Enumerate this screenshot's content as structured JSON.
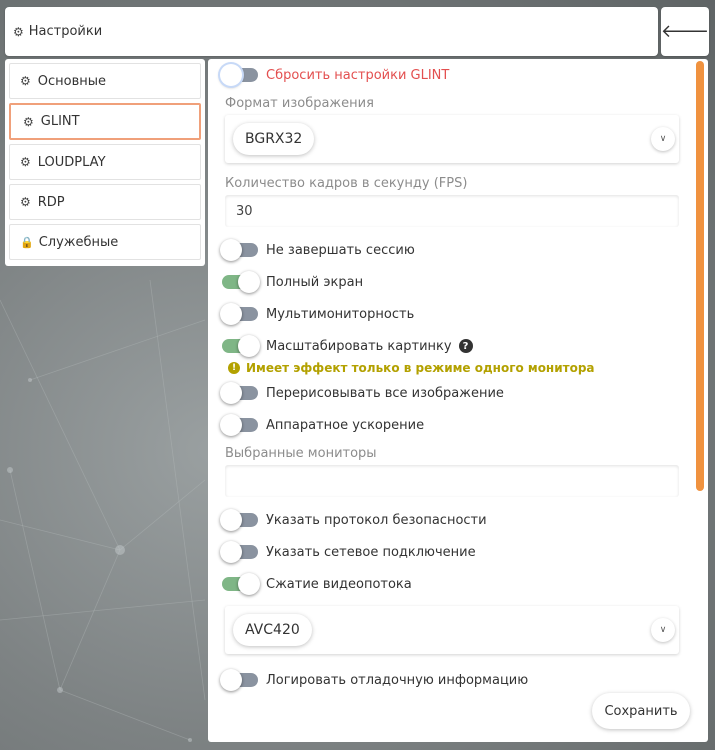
{
  "header": {
    "title": "Настройки",
    "back_icon": "arrow-left-icon"
  },
  "sidebar": {
    "items": [
      {
        "label": "Основные",
        "icon": "gear-icon",
        "active": false
      },
      {
        "label": "GLINT",
        "icon": "gear-icon",
        "active": true
      },
      {
        "label": "LOUDPLAY",
        "icon": "gear-icon",
        "active": false
      },
      {
        "label": "RDP",
        "icon": "gear-icon",
        "active": false
      },
      {
        "label": "Служебные",
        "icon": "lock-icon",
        "active": false
      }
    ]
  },
  "content": {
    "reset_glint": {
      "label": "Сбросить настройки GLINT",
      "on": false
    },
    "image_format": {
      "label": "Формат изображения",
      "value": "BGRX32"
    },
    "fps": {
      "label": "Количество кадров в секунду (FPS)",
      "value": "30"
    },
    "no_end_session": {
      "label": "Не завершать сессию",
      "on": false
    },
    "fullscreen": {
      "label": "Полный экран",
      "on": true
    },
    "multimonitor": {
      "label": "Мультимониторность",
      "on": false
    },
    "scale_picture": {
      "label": "Масштабировать картинку",
      "on": true
    },
    "scale_hint": "Имеет эффект только в режиме одного монитора",
    "redraw_all": {
      "label": "Перерисовывать все изображение",
      "on": false
    },
    "hw_accel": {
      "label": "Аппаратное ускорение",
      "on": false
    },
    "selected_monitors": {
      "label": "Выбранные мониторы",
      "value": ""
    },
    "security_protocol": {
      "label": "Указать протокол безопасности",
      "on": false
    },
    "network_connection": {
      "label": "Указать сетевое подключение",
      "on": false
    },
    "video_compression": {
      "label": "Сжатие видеопотока",
      "on": true
    },
    "codec": {
      "value": "AVC420"
    },
    "debug_log": {
      "label": "Логировать отладочную информацию",
      "on": false
    },
    "save_label": "Сохранить"
  },
  "colors": {
    "accent": "#f0923f",
    "toggle_on": "#7fb686",
    "toggle_off": "#8a93a0",
    "danger": "#e34f4f",
    "hint": "#b3a100"
  }
}
